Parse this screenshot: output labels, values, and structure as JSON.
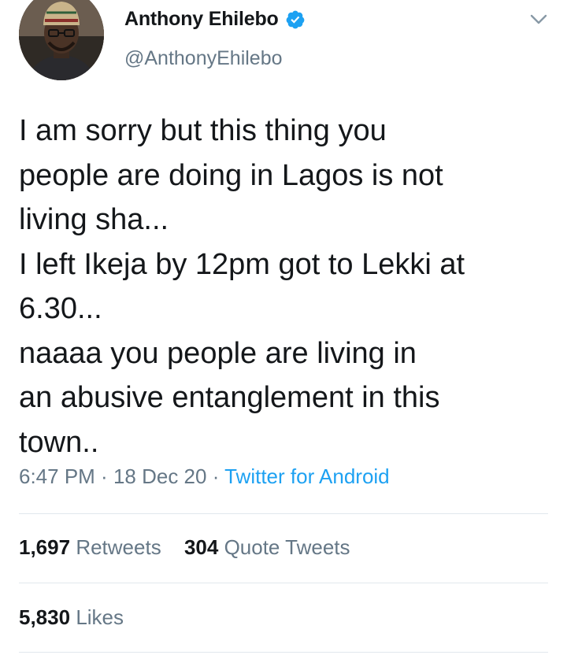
{
  "author": {
    "name": "Anthony Ehilebo",
    "handle": "@AnthonyEhilebo",
    "verified": true
  },
  "tweet": {
    "text": "I am sorry but this thing you\npeople are doing in Lagos is not\nliving sha...\nI left Ikeja by 12pm got to Lekki at\n6.30...\nnaaaa you people are living in\nan abusive entanglement in this\ntown..",
    "time": "6:47 PM",
    "date": "18 Dec 20",
    "separator": " · ",
    "source": "Twitter for Android"
  },
  "stats": {
    "retweets_count": "1,697",
    "retweets_label": "Retweets",
    "quotes_count": "304",
    "quotes_label": "Quote Tweets",
    "likes_count": "5,830",
    "likes_label": "Likes"
  },
  "colors": {
    "text": "#14171a",
    "secondary": "#657786",
    "link": "#1da1f2",
    "divider": "#e1e8ed",
    "verified": "#1da1f2"
  },
  "icons": {
    "verified": "verified-badge-icon",
    "menu": "chevron-down-icon"
  }
}
